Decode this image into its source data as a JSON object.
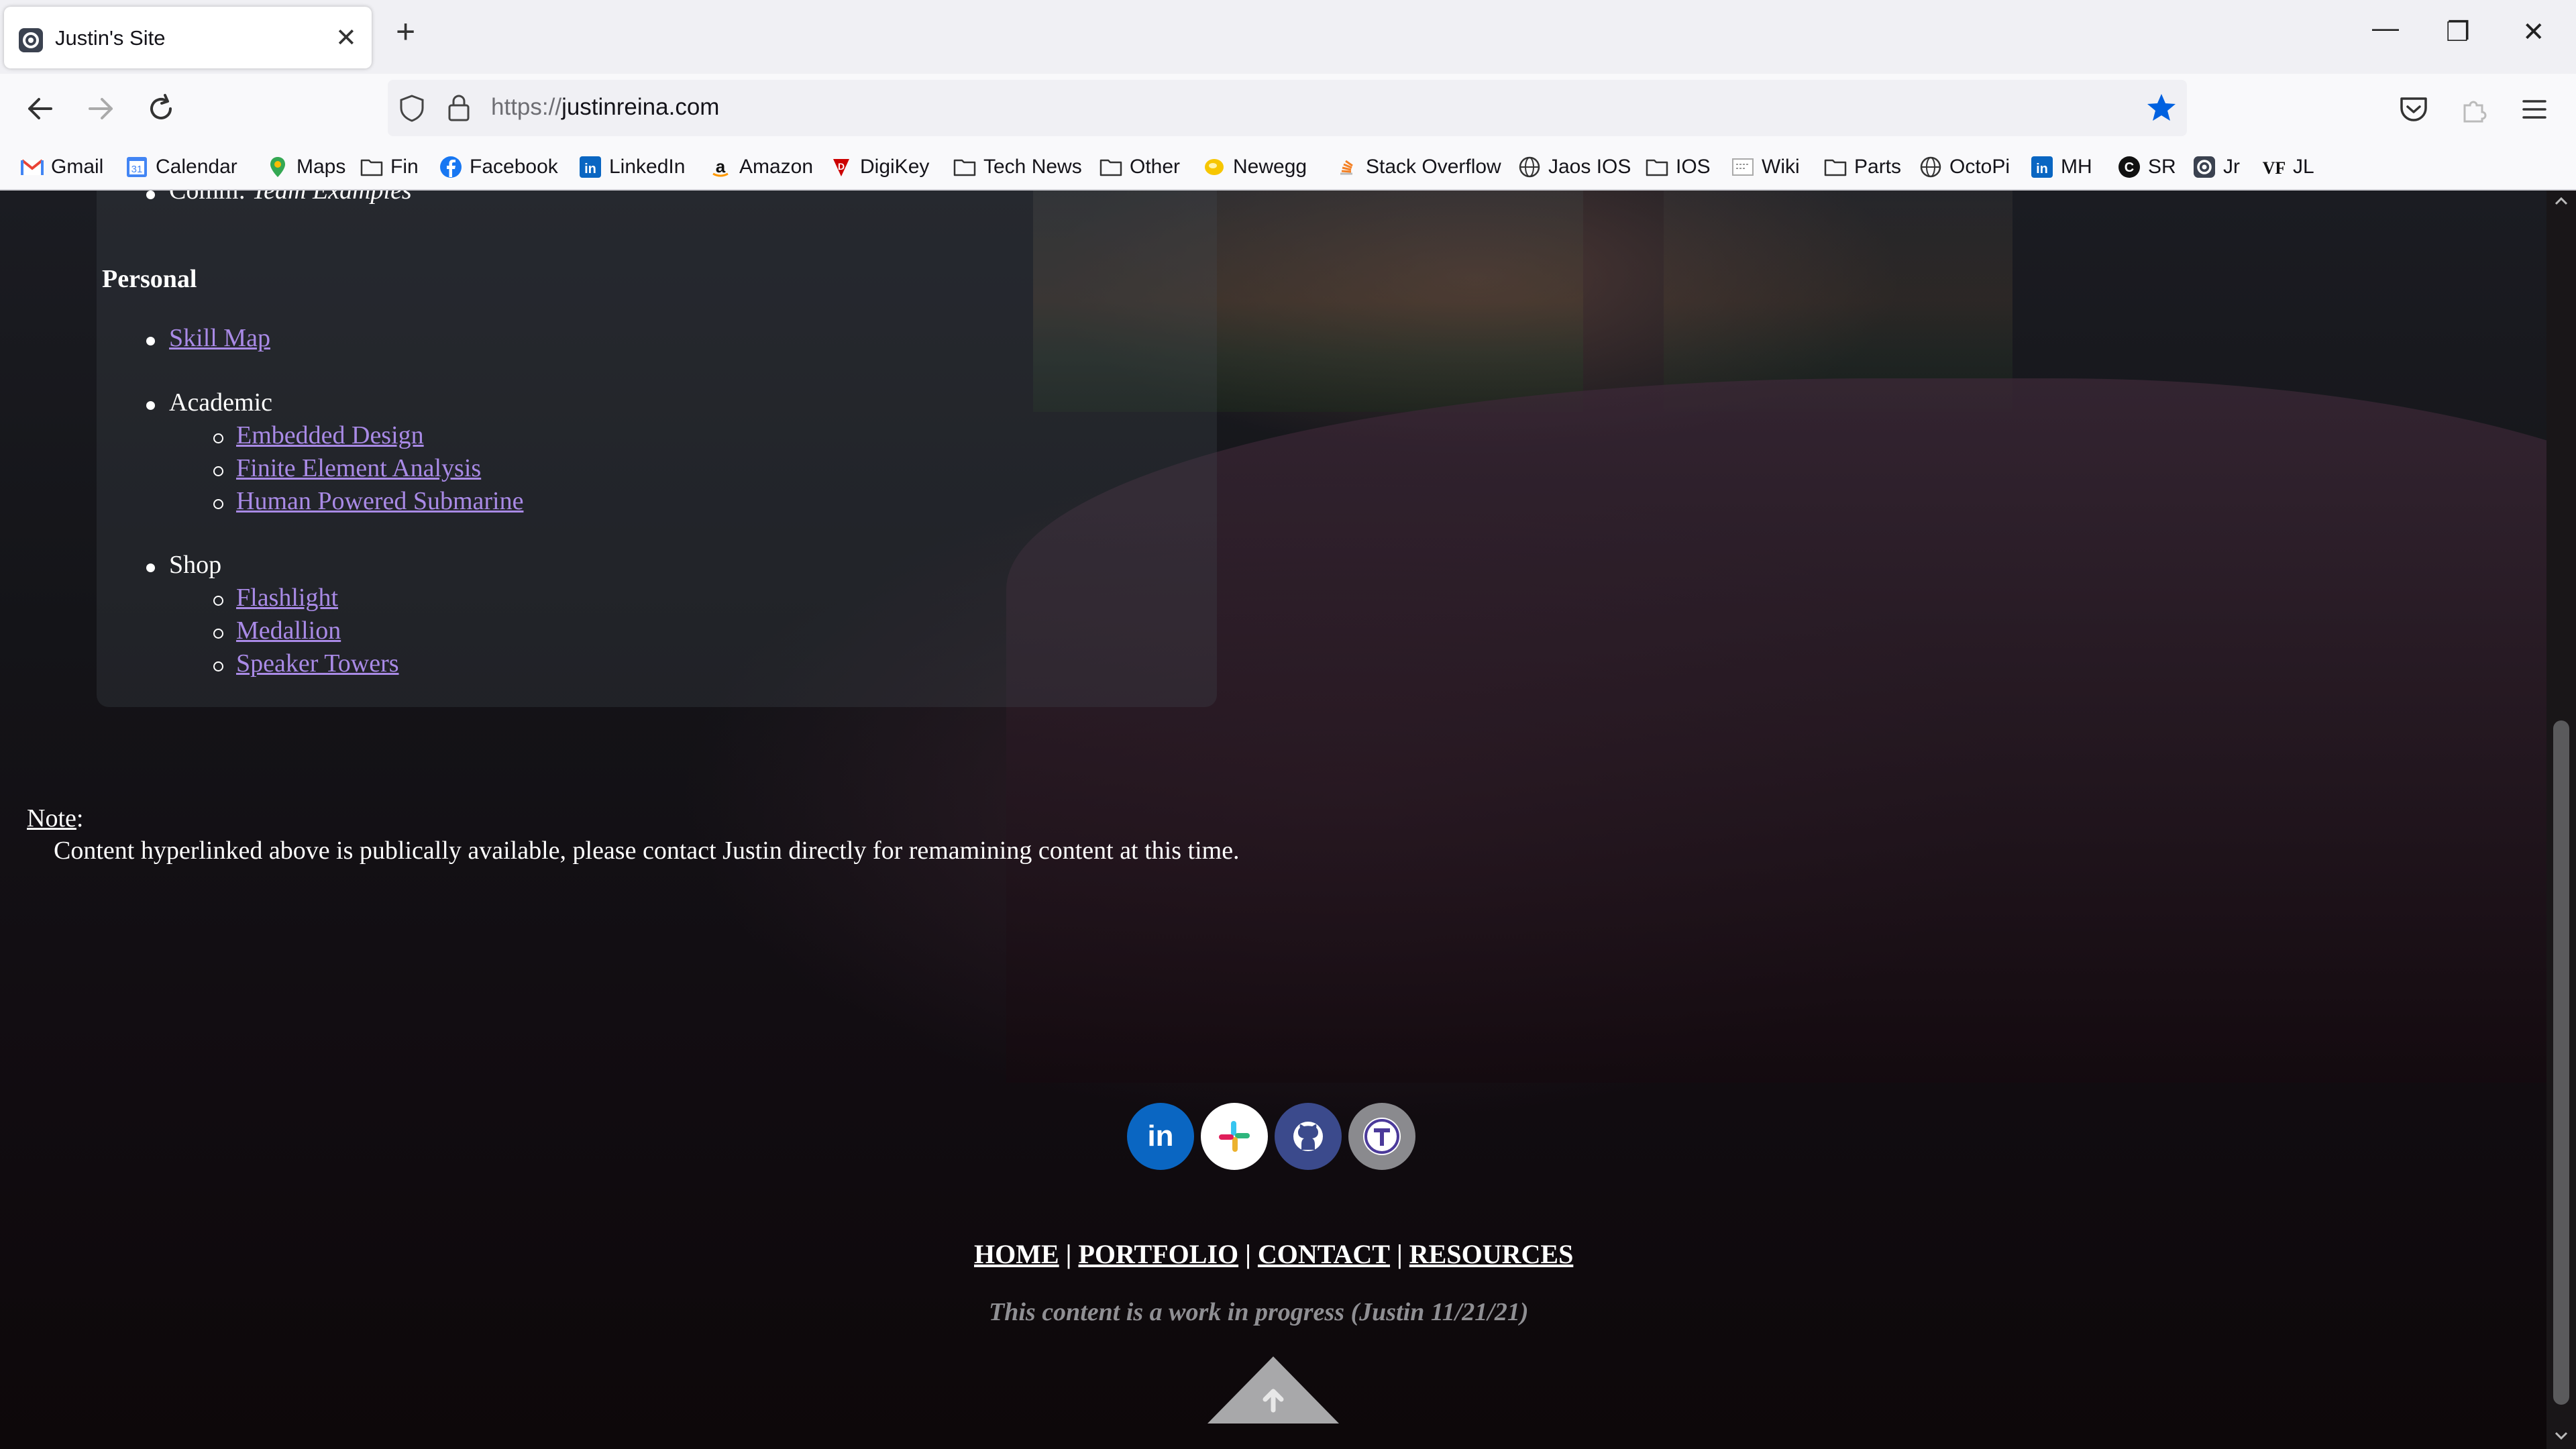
{
  "tab": {
    "title": "Justin's Site",
    "close": "✕"
  },
  "newtab": "+",
  "window_controls": {
    "minimize": "—",
    "restore": "❐",
    "close": "✕"
  },
  "url": {
    "scheme": "https://",
    "host": "justinreina.com"
  },
  "bookmarks": [
    {
      "label": "Gmail",
      "icon": "gmail-icon"
    },
    {
      "label": "Calendar",
      "icon": "calendar-icon"
    },
    {
      "label": "Maps",
      "icon": "maps-icon"
    },
    {
      "label": "Fin",
      "icon": "folder-icon"
    },
    {
      "label": "Facebook",
      "icon": "facebook-icon"
    },
    {
      "label": "LinkedIn",
      "icon": "linkedin-icon"
    },
    {
      "label": "Amazon",
      "icon": "amazon-icon"
    },
    {
      "label": "DigiKey",
      "icon": "digikey-icon"
    },
    {
      "label": "Tech News",
      "icon": "folder-icon"
    },
    {
      "label": "Other",
      "icon": "folder-icon"
    },
    {
      "label": "Newegg",
      "icon": "newegg-icon"
    },
    {
      "label": "Stack Overflow",
      "icon": "stackoverflow-icon"
    },
    {
      "label": "Jaos IOS",
      "icon": "globe-icon"
    },
    {
      "label": "IOS",
      "icon": "folder-icon"
    },
    {
      "label": "Wiki",
      "icon": "wiki-icon"
    },
    {
      "label": "Parts",
      "icon": "folder-icon"
    },
    {
      "label": "OctoPi",
      "icon": "globe-icon"
    },
    {
      "label": "MH",
      "icon": "linkedin-icon"
    },
    {
      "label": "SR",
      "icon": "sr-icon"
    },
    {
      "label": "Jr",
      "icon": "gear-icon"
    },
    {
      "label": "JL",
      "icon": "vf-icon"
    }
  ],
  "content": {
    "partial_item": {
      "label": "Comm: ",
      "italic": "Team Examples"
    },
    "personal_heading": "Personal",
    "skill_map": "Skill Map",
    "academic": "Academic",
    "academic_items": [
      "Embedded Design",
      "Finite Element Analysis",
      "Human Powered Submarine"
    ],
    "shop": "Shop",
    "shop_items": [
      "Flashlight",
      "Medallion",
      "Speaker Towers"
    ],
    "note_label": "Note",
    "note_colon": ":",
    "note_text": "Content hyperlinked above is publically available, please contact Justin directly for remamining content at this time."
  },
  "social": [
    {
      "name": "linkedin-icon",
      "glyph": "in",
      "bg": "#0a66c2",
      "fg": "#ffffff"
    },
    {
      "name": "slack-icon",
      "glyph": "",
      "bg": "#ffffff",
      "fg": "#000000"
    },
    {
      "name": "github-icon",
      "glyph": "",
      "bg": "#3b4a8c",
      "fg": "#ffffff"
    },
    {
      "name": "teams-icon",
      "glyph": "T",
      "bg": "#8a8a8e",
      "fg": "#4b3a9a"
    }
  ],
  "footer": {
    "nav": [
      "HOME",
      "PORTFOLIO",
      "CONTACT",
      "RESOURCES"
    ],
    "separator": "|",
    "wip": "This content is a work in progress (Justin 11/21/21)"
  }
}
